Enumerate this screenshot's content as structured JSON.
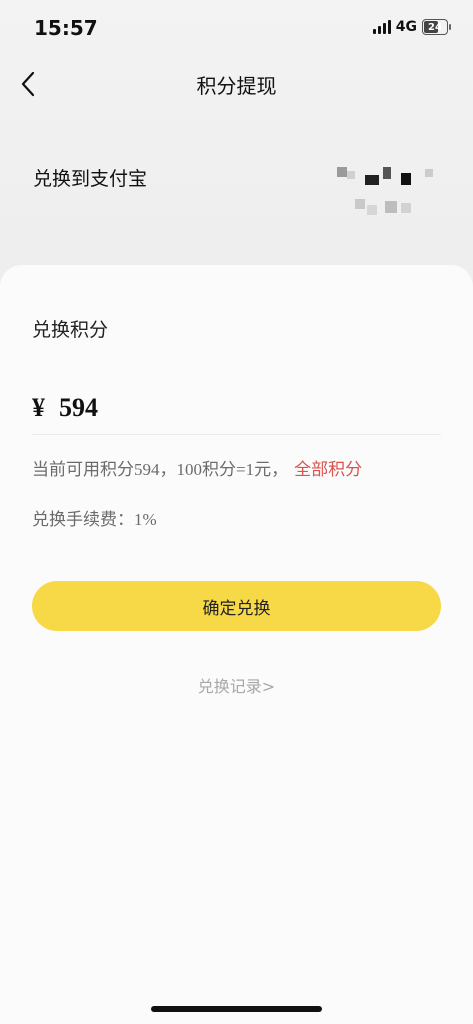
{
  "status_bar": {
    "time": "15:57",
    "network": "4G",
    "battery": "24"
  },
  "nav": {
    "title": "积分提现"
  },
  "account": {
    "label": "兑换到支付宝"
  },
  "exchange": {
    "section_label": "兑换积分",
    "currency_symbol": "¥",
    "amount": "594",
    "available_text": "当前可用积分594，100积分=1元，",
    "all_points_link": "全部积分",
    "fee_text": "兑换手续费：1%",
    "confirm_button": "确定兑换",
    "history_link": "兑换记录>"
  },
  "colors": {
    "accent_yellow": "#f7d948",
    "link_red": "#d9534f",
    "muted_text": "#6b6b6b",
    "history_text": "#a8a8a8"
  }
}
